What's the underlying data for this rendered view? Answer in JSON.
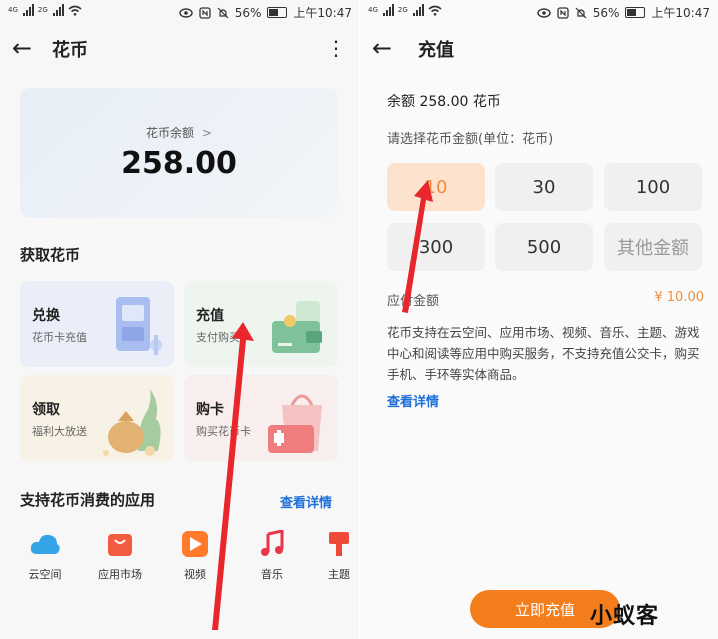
{
  "status_left": {
    "network1": "4G",
    "network2": "2G"
  },
  "status_right": {
    "battery": "56%",
    "time": "上午10:47"
  },
  "left": {
    "title": "花币",
    "balance_label": "花币余额",
    "balance_chevron": ">",
    "balance_value": "258.00",
    "get_title": "获取花币",
    "tiles": [
      {
        "title": "兑换",
        "sub": "花币卡充值"
      },
      {
        "title": "充值",
        "sub": "支付购买"
      },
      {
        "title": "领取",
        "sub": "福利大放送"
      },
      {
        "title": "购卡",
        "sub": "购买花币卡"
      }
    ],
    "apps_title": "支持花币消费的应用",
    "view_details": "查看详情",
    "apps": [
      {
        "label": "云空间",
        "icon": "cloud-icon"
      },
      {
        "label": "应用市场",
        "icon": "app-market-icon"
      },
      {
        "label": "视频",
        "icon": "video-icon"
      },
      {
        "label": "音乐",
        "icon": "music-icon"
      },
      {
        "label": "主题",
        "icon": "theme-brush-icon"
      }
    ]
  },
  "right": {
    "title": "充值",
    "balance_text": "余额  258.00 花币",
    "choose_label": "请选择花币金额(单位：花币)",
    "amounts": [
      "10",
      "30",
      "100",
      "300",
      "500",
      "其他金额"
    ],
    "selected_amount": "10",
    "pay_label": "应付金额",
    "pay_value": "¥ 10.00",
    "description": "花币支持在云空间、应用市场、视频、音乐、主题、游戏中心和阅读等应用中购买服务，不支持充值公交卡，购买手机、手环等实体商品。",
    "details_link": "查看详情",
    "recharge_button": "立即充值",
    "watermark": "小蚁客"
  },
  "colors": {
    "accent": "#f57e1c",
    "link": "#1e6fd9",
    "selected_bg": "#fde3cd",
    "arrow": "#e8262c"
  }
}
